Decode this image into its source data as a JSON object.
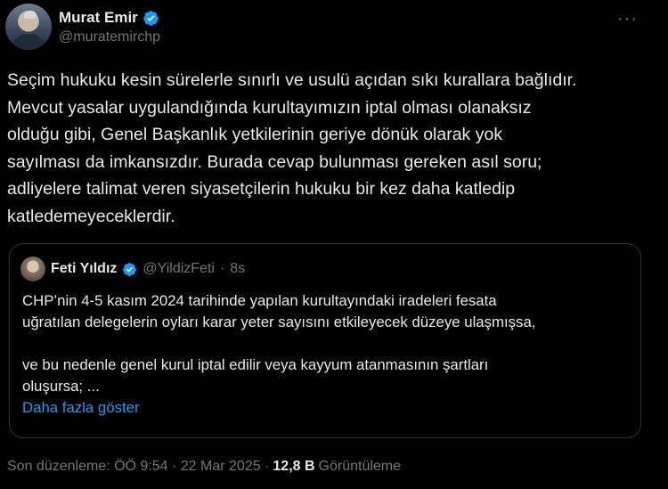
{
  "author": {
    "display_name": "Murat Emir",
    "handle": "@muratemirchp"
  },
  "more_label": "···",
  "body": "Seçim hukuku kesin sürelerle sınırlı ve usulü açıdan sıkı kurallara bağlıdır.\nMevcut yasalar uygulandığında kurultayımızın iptal olması olanaksız\nolduğu gibi, Genel Başkanlık yetkilerinin geriye dönük olarak yok\nsayılması da imkansızdır. Burada cevap bulunması gereken asıl soru;\nadliyelere talimat veren siyasetçilerin hukuku bir kez daha katledip\nkatledemeyeceklerdir.",
  "quote": {
    "display_name": "Feti Yıldız",
    "handle": "@YildizFeti",
    "separator": "·",
    "time": "8s",
    "text": "CHP’nin 4-5 kasım 2024 tarihinde yapılan kurultayındaki iradeleri fesata\nuğratılan delegelerin oyları  karar yeter sayısını etkileyecek düzeye ulaşmışsa,\n\nve bu nedenle genel kurul iptal edilir veya kayyum atanmasının şartları\noluşursa; ...",
    "show_more": "Daha fazla göster"
  },
  "meta": {
    "edited": "Son düzenleme: ÖÖ 9:54 · 22 Mar 2025 ·",
    "views_count": "12,8 B",
    "views_label": "Görüntüleme"
  },
  "colors": {
    "background": "#000000",
    "text": "#e7e9ea",
    "secondary": "#71767b",
    "accent": "#1d9bf0",
    "border": "#2f3336"
  }
}
